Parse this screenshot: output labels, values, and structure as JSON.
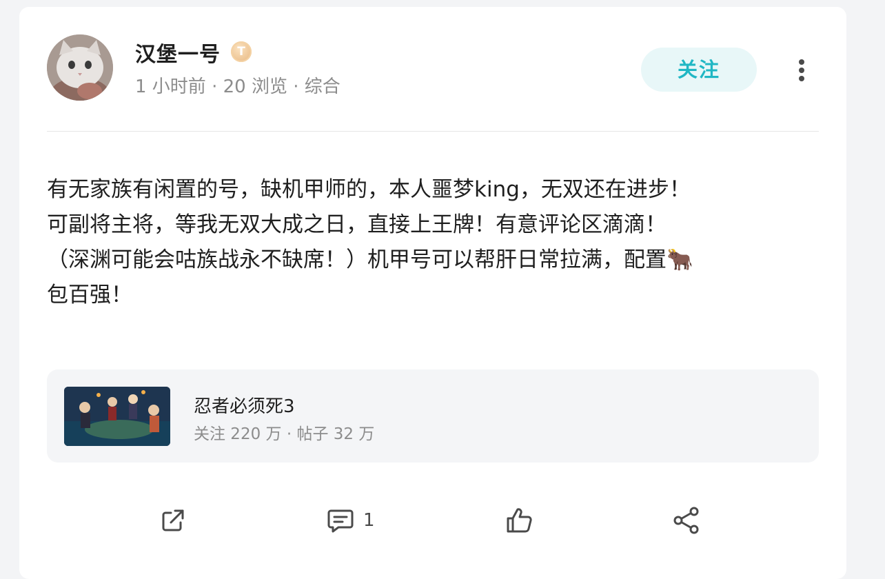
{
  "post": {
    "author": {
      "name": "汉堡一号",
      "badge_letter": "T",
      "avatar": "cat-avatar"
    },
    "meta": "1 小时前 · 20 浏览 · 综合",
    "follow_label": "关注",
    "content_lines": [
      "有无家族有闲置的号，缺机甲师的，本人噩梦king，无双还在进步！",
      "可副将主将，等我无双大成之日，直接上王牌！有意评论区滴滴！",
      "（深渊可能会咕族战永不缺席！）机甲号可以帮肝日常拉满，配置🐂",
      "包百强！"
    ]
  },
  "forum": {
    "name": "忍者必须死3",
    "stats": "关注 220 万 · 帖子 32 万"
  },
  "actions": {
    "comment_count": "1",
    "icons": [
      "external-share-icon",
      "comment-icon",
      "like-icon",
      "share-icon"
    ]
  },
  "colors": {
    "accent": "#20b7c4",
    "accent_bg": "#e8f7f8",
    "text": "#1f1f1f",
    "muted": "#8c8c8c",
    "card_bg": "#f4f5f7"
  }
}
